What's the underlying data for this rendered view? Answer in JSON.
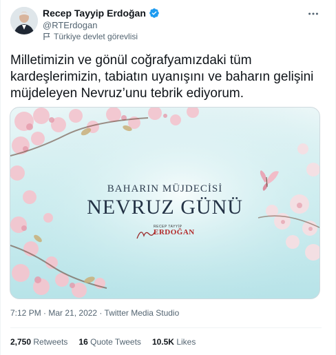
{
  "author": {
    "display_name": "Recep Tayyip Erdoğan",
    "handle": "@RTErdogan",
    "account_label": "Türkiye devlet görevlisi",
    "verified_icon": "verified-badge-icon",
    "label_icon": "flag-icon"
  },
  "tweet": {
    "text": "Milletimizin ve gönül coğrafyamızdaki tüm kardeşlerimizin, tabiatın uyanışını ve baharın gelişini müjdeleyen Nevruz’unu tebrik ediyorum."
  },
  "media": {
    "subtitle": "BAHARIN MÜJDECİSİ",
    "title": "NEVRUZ GÜNÜ",
    "signature_top": "RECEP TAYYİP",
    "signature_name": "ERDOĞAN"
  },
  "meta": {
    "time": "7:12 PM",
    "separator1": " · ",
    "date": "Mar 21, 2022",
    "separator2": " · ",
    "source": "Twitter Media Studio"
  },
  "stats": {
    "retweets_count": "2,750",
    "retweets_label": "Retweets",
    "quotes_count": "16",
    "quotes_label": "Quote Tweets",
    "likes_count": "10.5K",
    "likes_label": "Likes"
  },
  "colors": {
    "accent": "#1d9bf0",
    "secondary_text": "#536471",
    "primary_text": "#0f1419"
  }
}
